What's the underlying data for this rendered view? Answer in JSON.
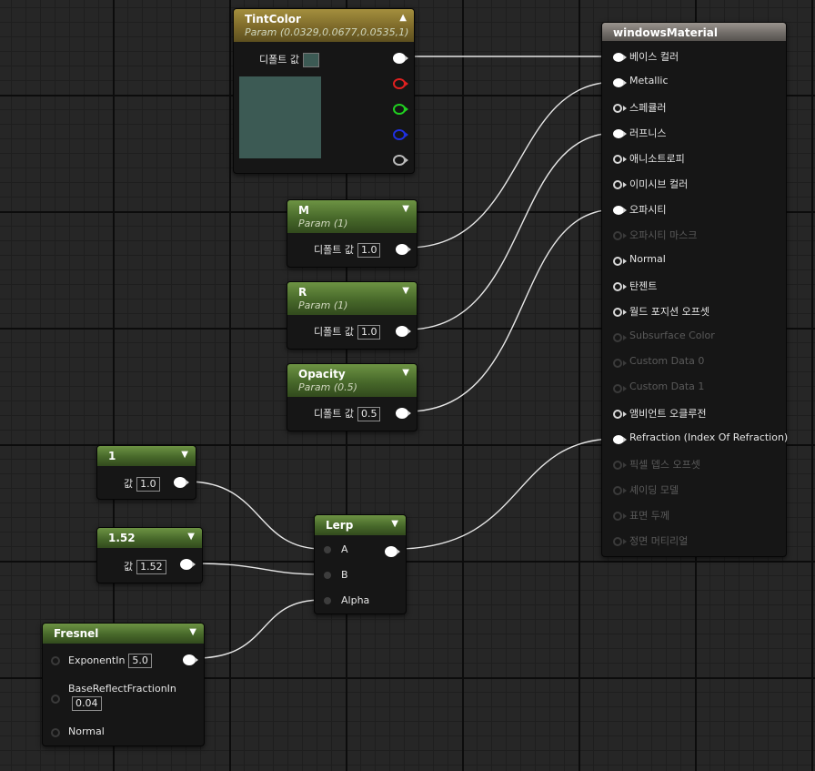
{
  "nodes": {
    "tint": {
      "title": "TintColor",
      "subtitle": "Param (0.0329,0.0677,0.0535,1)",
      "default_label": "디폴트 값",
      "color": "#3c5a54"
    },
    "m": {
      "title": "M",
      "subtitle": "Param (1)",
      "default_label": "디폴트 값",
      "value": "1.0"
    },
    "r": {
      "title": "R",
      "subtitle": "Param (1)",
      "default_label": "디폴트 값",
      "value": "1.0"
    },
    "opacity": {
      "title": "Opacity",
      "subtitle": "Param (0.5)",
      "default_label": "디폴트 값",
      "value": "0.5"
    },
    "c1": {
      "title": "1",
      "label": "값",
      "value": "1.0"
    },
    "c152": {
      "title": "1.52",
      "label": "값",
      "value": "1.52"
    },
    "lerp": {
      "title": "Lerp",
      "inputs": [
        "A",
        "B",
        "Alpha"
      ]
    },
    "fresnel": {
      "title": "Fresnel",
      "exponent_label": "ExponentIn",
      "exponent_value": "5.0",
      "base_label": "BaseReflectFractionIn",
      "base_value": "0.04",
      "normal_label": "Normal"
    },
    "material": {
      "title": "windowsMaterial",
      "pins": [
        {
          "label": "베이스 컬러",
          "active": true,
          "connected": true
        },
        {
          "label": "Metallic",
          "active": true,
          "connected": true
        },
        {
          "label": "스페큘러",
          "active": true,
          "connected": false
        },
        {
          "label": "러프니스",
          "active": true,
          "connected": true
        },
        {
          "label": "애니소트로피",
          "active": true,
          "connected": false
        },
        {
          "label": "이미시브 컬러",
          "active": true,
          "connected": false
        },
        {
          "label": "오파시티",
          "active": true,
          "connected": true
        },
        {
          "label": "오파시티 마스크",
          "active": false,
          "connected": false
        },
        {
          "label": "Normal",
          "active": true,
          "connected": false
        },
        {
          "label": "탄젠트",
          "active": true,
          "connected": false
        },
        {
          "label": "월드 포지션 오프셋",
          "active": true,
          "connected": false
        },
        {
          "label": "Subsurface Color",
          "active": false,
          "connected": false
        },
        {
          "label": "Custom Data 0",
          "active": false,
          "connected": false
        },
        {
          "label": "Custom Data 1",
          "active": false,
          "connected": false
        },
        {
          "label": "앰비언트 오클루전",
          "active": true,
          "connected": false
        },
        {
          "label": "Refraction (Index Of Refraction)",
          "active": true,
          "connected": true
        },
        {
          "label": "픽셀 뎁스 오프셋",
          "active": false,
          "connected": false
        },
        {
          "label": "셰이딩 모델",
          "active": false,
          "connected": false
        },
        {
          "label": "표면 두께",
          "active": false,
          "connected": false
        },
        {
          "label": "정면 머티리얼",
          "active": false,
          "connected": false
        }
      ]
    }
  },
  "colors": {
    "wire": "#e6e6e6",
    "green_header": "#47682a",
    "gold_header": "#7d6a2a",
    "grey_header": "#6f6a66"
  }
}
